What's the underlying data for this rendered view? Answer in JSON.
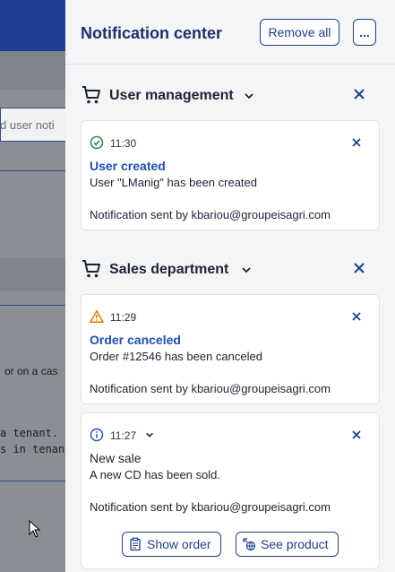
{
  "background": {
    "input_fragment": "d user noti",
    "text_fragment_1": "or on a cas",
    "text_fragment_2": "a tenant.",
    "text_fragment_3": "s in tenan"
  },
  "panel": {
    "title": "Notification center",
    "remove_all_label": "Remove all",
    "more_label": "..."
  },
  "groups": [
    {
      "title": "User management",
      "icon": "cart-icon",
      "notifications": [
        {
          "status_icon": "success-check-icon",
          "time": "11:30",
          "title": "User created",
          "body": "User \"LManig\" has been created",
          "sent": "Notification sent by kbariou@groupeisagri.com"
        }
      ]
    },
    {
      "title": "Sales department",
      "icon": "cart-icon",
      "notifications": [
        {
          "status_icon": "warning-icon",
          "time": "11:29",
          "title": "Order canceled",
          "body": "Order #12546 has been canceled",
          "sent": "Notification sent by kbariou@groupeisagri.com"
        },
        {
          "status_icon": "info-icon",
          "time": "11:27",
          "title": "New sale",
          "body": "A new CD has been sold.",
          "sent": "Notification sent by kbariou@groupeisagri.com",
          "actions": [
            "Show order",
            "See product"
          ]
        }
      ]
    }
  ],
  "colors": {
    "brand": "#1c3f92",
    "link_title": "#1f4fb5",
    "success": "#1e8a3a",
    "warning": "#e07b00",
    "info": "#1f4fb5"
  }
}
